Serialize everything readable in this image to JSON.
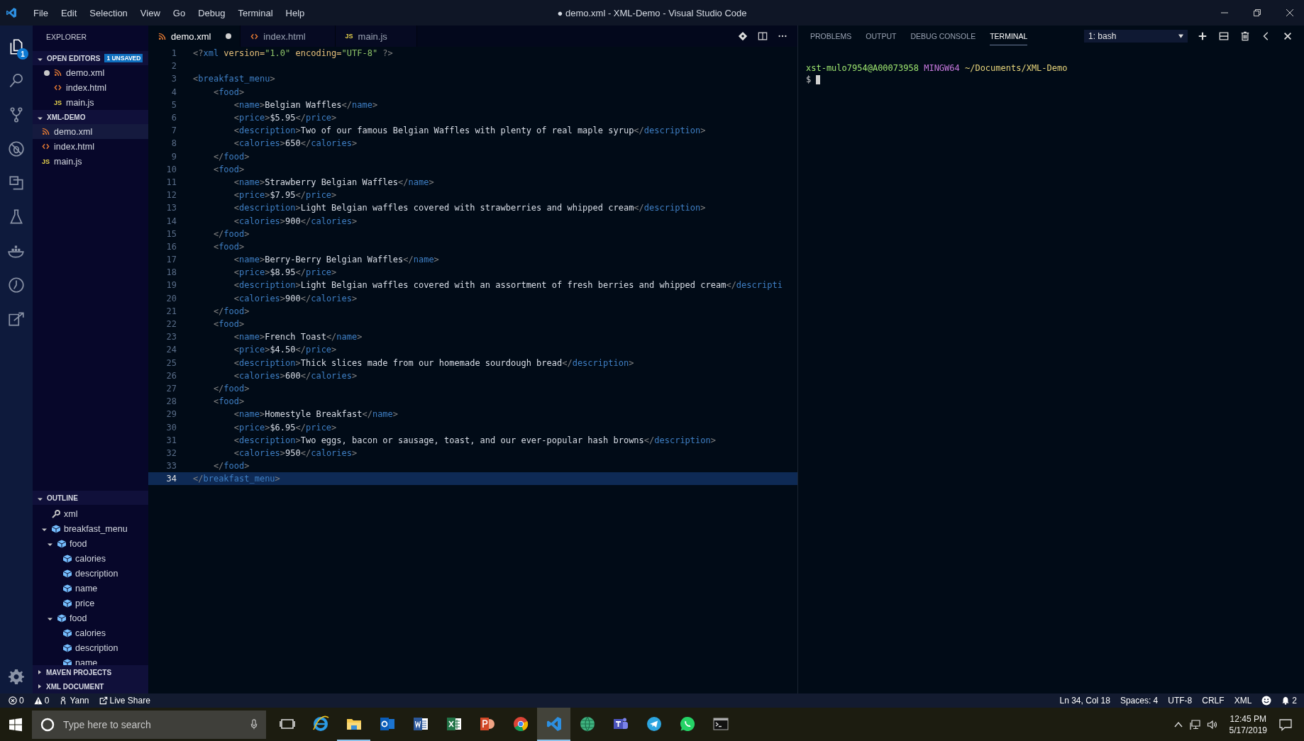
{
  "window": {
    "title": "● demo.xml - XML-Demo - Visual Studio Code"
  },
  "menu": [
    "File",
    "Edit",
    "Selection",
    "View",
    "Go",
    "Debug",
    "Terminal",
    "Help"
  ],
  "activity_bar": [
    {
      "kind": "files",
      "selected": true,
      "badge": "1"
    },
    {
      "kind": "search",
      "selected": false
    },
    {
      "kind": "source-control",
      "selected": false
    },
    {
      "kind": "debug",
      "selected": false
    },
    {
      "kind": "extensions",
      "selected": false
    },
    {
      "kind": "flask",
      "selected": false
    },
    {
      "kind": "whale",
      "selected": false
    },
    {
      "kind": "history",
      "selected": false
    },
    {
      "kind": "share",
      "selected": false
    }
  ],
  "sidebar": {
    "title": "EXPLORER",
    "open_editors": {
      "title": "OPEN EDITORS",
      "badge": "1 UNSAVED",
      "expanded": true,
      "items": [
        {
          "name": "demo.xml",
          "kind": "xml",
          "dirty": true,
          "selected": false
        },
        {
          "name": "index.html",
          "kind": "html",
          "dirty": false,
          "selected": false
        },
        {
          "name": "main.js",
          "kind": "js",
          "icon_label": "JS",
          "dirty": false,
          "selected": false
        }
      ]
    },
    "folder": {
      "title": "XML-DEMO",
      "expanded": true,
      "items": [
        {
          "name": "demo.xml",
          "kind": "xml",
          "selected": true
        },
        {
          "name": "index.html",
          "kind": "html",
          "selected": false
        },
        {
          "name": "main.js",
          "kind": "js",
          "icon_label": "JS",
          "selected": false
        }
      ]
    },
    "outline": {
      "title": "OUTLINE",
      "expanded": true,
      "items": [
        {
          "label": "xml",
          "kind": "key"
        },
        {
          "label": "breakfast_menu",
          "kind": "element",
          "expanded": true,
          "children": [
            {
              "label": "food",
              "kind": "element",
              "expanded": true,
              "children": [
                {
                  "label": "calories",
                  "kind": "element"
                },
                {
                  "label": "description",
                  "kind": "element"
                },
                {
                  "label": "name",
                  "kind": "element"
                },
                {
                  "label": "price",
                  "kind": "element"
                }
              ]
            },
            {
              "label": "food",
              "kind": "element",
              "expanded": true,
              "children": [
                {
                  "label": "calories",
                  "kind": "element"
                },
                {
                  "label": "description",
                  "kind": "element"
                },
                {
                  "label": "name",
                  "kind": "element"
                }
              ]
            }
          ]
        }
      ]
    },
    "collapsed_sections": [
      {
        "title": "MAVEN PROJECTS",
        "expanded": false
      },
      {
        "title": "XML DOCUMENT",
        "expanded": false
      }
    ]
  },
  "tabs": [
    {
      "label": "demo.xml",
      "kind": "xml",
      "dirty": true,
      "selected": true
    },
    {
      "label": "index.html",
      "kind": "html",
      "dirty": false,
      "selected": false
    },
    {
      "label": "main.js",
      "kind": "js",
      "icon_label": "JS",
      "dirty": false,
      "selected": false
    }
  ],
  "editor": {
    "lines": [
      {
        "n": "1",
        "current": false,
        "tokens": [
          {
            "kind": "mark",
            "text": "<?"
          },
          {
            "kind": "tag",
            "text": "xml"
          },
          {
            "kind": "attr",
            "text": " version="
          },
          {
            "kind": "str",
            "text": "\"1.0\""
          },
          {
            "kind": "attr",
            "text": " encoding="
          },
          {
            "kind": "str",
            "text": "\"UTF-8\""
          },
          {
            "kind": "mark",
            "text": " ?>"
          }
        ]
      },
      {
        "n": "2",
        "current": false
      },
      {
        "n": "3",
        "current": false,
        "tokens": [
          {
            "kind": "mark",
            "text": "<"
          },
          {
            "kind": "tag",
            "text": "breakfast_menu"
          },
          {
            "kind": "mark",
            "text": ">"
          }
        ]
      },
      {
        "n": "4",
        "current": false,
        "tokens": [
          {
            "kind": "mark",
            "text": "    <"
          },
          {
            "kind": "tag",
            "text": "food"
          },
          {
            "kind": "mark",
            "text": ">"
          }
        ]
      },
      {
        "n": "5",
        "current": false,
        "tokens": [
          {
            "kind": "mark",
            "text": "        <"
          },
          {
            "kind": "tag",
            "text": "name"
          },
          {
            "kind": "mark",
            "text": ">"
          },
          {
            "kind": "text",
            "text": "Belgian Waffles"
          },
          {
            "kind": "mark",
            "text": "</"
          },
          {
            "kind": "tag",
            "text": "name"
          },
          {
            "kind": "mark",
            "text": ">"
          }
        ]
      },
      {
        "n": "6",
        "current": false,
        "tokens": [
          {
            "kind": "mark",
            "text": "        <"
          },
          {
            "kind": "tag",
            "text": "price"
          },
          {
            "kind": "mark",
            "text": ">"
          },
          {
            "kind": "text",
            "text": "$5.95"
          },
          {
            "kind": "mark",
            "text": "</"
          },
          {
            "kind": "tag",
            "text": "price"
          },
          {
            "kind": "mark",
            "text": ">"
          }
        ]
      },
      {
        "n": "7",
        "current": false,
        "tokens": [
          {
            "kind": "mark",
            "text": "        <"
          },
          {
            "kind": "tag",
            "text": "description"
          },
          {
            "kind": "mark",
            "text": ">"
          },
          {
            "kind": "text",
            "text": "Two of our famous Belgian Waffles with plenty of real maple syrup"
          },
          {
            "kind": "mark",
            "text": "</"
          },
          {
            "kind": "tag",
            "text": "description"
          },
          {
            "kind": "mark",
            "text": ">"
          }
        ]
      },
      {
        "n": "8",
        "current": false,
        "tokens": [
          {
            "kind": "mark",
            "text": "        <"
          },
          {
            "kind": "tag",
            "text": "calories"
          },
          {
            "kind": "mark",
            "text": ">"
          },
          {
            "kind": "text",
            "text": "650"
          },
          {
            "kind": "mark",
            "text": "</"
          },
          {
            "kind": "tag",
            "text": "calories"
          },
          {
            "kind": "mark",
            "text": ">"
          }
        ]
      },
      {
        "n": "9",
        "current": false,
        "tokens": [
          {
            "kind": "mark",
            "text": "    </"
          },
          {
            "kind": "tag",
            "text": "food"
          },
          {
            "kind": "mark",
            "text": ">"
          }
        ]
      },
      {
        "n": "10",
        "current": false,
        "tokens": [
          {
            "kind": "mark",
            "text": "    <"
          },
          {
            "kind": "tag",
            "text": "food"
          },
          {
            "kind": "mark",
            "text": ">"
          }
        ]
      },
      {
        "n": "11",
        "current": false,
        "tokens": [
          {
            "kind": "mark",
            "text": "        <"
          },
          {
            "kind": "tag",
            "text": "name"
          },
          {
            "kind": "mark",
            "text": ">"
          },
          {
            "kind": "text",
            "text": "Strawberry Belgian Waffles"
          },
          {
            "kind": "mark",
            "text": "</"
          },
          {
            "kind": "tag",
            "text": "name"
          },
          {
            "kind": "mark",
            "text": ">"
          }
        ]
      },
      {
        "n": "12",
        "current": false,
        "tokens": [
          {
            "kind": "mark",
            "text": "        <"
          },
          {
            "kind": "tag",
            "text": "price"
          },
          {
            "kind": "mark",
            "text": ">"
          },
          {
            "kind": "text",
            "text": "$7.95"
          },
          {
            "kind": "mark",
            "text": "</"
          },
          {
            "kind": "tag",
            "text": "price"
          },
          {
            "kind": "mark",
            "text": ">"
          }
        ]
      },
      {
        "n": "13",
        "current": false,
        "tokens": [
          {
            "kind": "mark",
            "text": "        <"
          },
          {
            "kind": "tag",
            "text": "description"
          },
          {
            "kind": "mark",
            "text": ">"
          },
          {
            "kind": "text",
            "text": "Light Belgian waffles covered with strawberries and whipped cream"
          },
          {
            "kind": "mark",
            "text": "</"
          },
          {
            "kind": "tag",
            "text": "description"
          },
          {
            "kind": "mark",
            "text": ">"
          }
        ]
      },
      {
        "n": "14",
        "current": false,
        "tokens": [
          {
            "kind": "mark",
            "text": "        <"
          },
          {
            "kind": "tag",
            "text": "calories"
          },
          {
            "kind": "mark",
            "text": ">"
          },
          {
            "kind": "text",
            "text": "900"
          },
          {
            "kind": "mark",
            "text": "</"
          },
          {
            "kind": "tag",
            "text": "calories"
          },
          {
            "kind": "mark",
            "text": ">"
          }
        ]
      },
      {
        "n": "15",
        "current": false,
        "tokens": [
          {
            "kind": "mark",
            "text": "    </"
          },
          {
            "kind": "tag",
            "text": "food"
          },
          {
            "kind": "mark",
            "text": ">"
          }
        ]
      },
      {
        "n": "16",
        "current": false,
        "tokens": [
          {
            "kind": "mark",
            "text": "    <"
          },
          {
            "kind": "tag",
            "text": "food"
          },
          {
            "kind": "mark",
            "text": ">"
          }
        ]
      },
      {
        "n": "17",
        "current": false,
        "tokens": [
          {
            "kind": "mark",
            "text": "        <"
          },
          {
            "kind": "tag",
            "text": "name"
          },
          {
            "kind": "mark",
            "text": ">"
          },
          {
            "kind": "text",
            "text": "Berry-Berry Belgian Waffles"
          },
          {
            "kind": "mark",
            "text": "</"
          },
          {
            "kind": "tag",
            "text": "name"
          },
          {
            "kind": "mark",
            "text": ">"
          }
        ]
      },
      {
        "n": "18",
        "current": false,
        "tokens": [
          {
            "kind": "mark",
            "text": "        <"
          },
          {
            "kind": "tag",
            "text": "price"
          },
          {
            "kind": "mark",
            "text": ">"
          },
          {
            "kind": "text",
            "text": "$8.95"
          },
          {
            "kind": "mark",
            "text": "</"
          },
          {
            "kind": "tag",
            "text": "price"
          },
          {
            "kind": "mark",
            "text": ">"
          }
        ]
      },
      {
        "n": "19",
        "current": false,
        "tokens": [
          {
            "kind": "mark",
            "text": "        <"
          },
          {
            "kind": "tag",
            "text": "description"
          },
          {
            "kind": "mark",
            "text": ">"
          },
          {
            "kind": "text",
            "text": "Light Belgian waffles covered with an assortment of fresh berries and whipped cream"
          },
          {
            "kind": "mark",
            "text": "</"
          },
          {
            "kind": "tag",
            "text": "descripti"
          }
        ]
      },
      {
        "n": "20",
        "current": false,
        "tokens": [
          {
            "kind": "mark",
            "text": "        <"
          },
          {
            "kind": "tag",
            "text": "calories"
          },
          {
            "kind": "mark",
            "text": ">"
          },
          {
            "kind": "text",
            "text": "900"
          },
          {
            "kind": "mark",
            "text": "</"
          },
          {
            "kind": "tag",
            "text": "calories"
          },
          {
            "kind": "mark",
            "text": ">"
          }
        ]
      },
      {
        "n": "21",
        "current": false,
        "tokens": [
          {
            "kind": "mark",
            "text": "    </"
          },
          {
            "kind": "tag",
            "text": "food"
          },
          {
            "kind": "mark",
            "text": ">"
          }
        ]
      },
      {
        "n": "22",
        "current": false,
        "tokens": [
          {
            "kind": "mark",
            "text": "    <"
          },
          {
            "kind": "tag",
            "text": "food"
          },
          {
            "kind": "mark",
            "text": ">"
          }
        ]
      },
      {
        "n": "23",
        "current": false,
        "tokens": [
          {
            "kind": "mark",
            "text": "        <"
          },
          {
            "kind": "tag",
            "text": "name"
          },
          {
            "kind": "mark",
            "text": ">"
          },
          {
            "kind": "text",
            "text": "French Toast"
          },
          {
            "kind": "mark",
            "text": "</"
          },
          {
            "kind": "tag",
            "text": "name"
          },
          {
            "kind": "mark",
            "text": ">"
          }
        ]
      },
      {
        "n": "24",
        "current": false,
        "tokens": [
          {
            "kind": "mark",
            "text": "        <"
          },
          {
            "kind": "tag",
            "text": "price"
          },
          {
            "kind": "mark",
            "text": ">"
          },
          {
            "kind": "text",
            "text": "$4.50"
          },
          {
            "kind": "mark",
            "text": "</"
          },
          {
            "kind": "tag",
            "text": "price"
          },
          {
            "kind": "mark",
            "text": ">"
          }
        ]
      },
      {
        "n": "25",
        "current": false,
        "tokens": [
          {
            "kind": "mark",
            "text": "        <"
          },
          {
            "kind": "tag",
            "text": "description"
          },
          {
            "kind": "mark",
            "text": ">"
          },
          {
            "kind": "text",
            "text": "Thick slices made from our homemade sourdough bread"
          },
          {
            "kind": "mark",
            "text": "</"
          },
          {
            "kind": "tag",
            "text": "description"
          },
          {
            "kind": "mark",
            "text": ">"
          }
        ]
      },
      {
        "n": "26",
        "current": false,
        "tokens": [
          {
            "kind": "mark",
            "text": "        <"
          },
          {
            "kind": "tag",
            "text": "calories"
          },
          {
            "kind": "mark",
            "text": ">"
          },
          {
            "kind": "text",
            "text": "600"
          },
          {
            "kind": "mark",
            "text": "</"
          },
          {
            "kind": "tag",
            "text": "calories"
          },
          {
            "kind": "mark",
            "text": ">"
          }
        ]
      },
      {
        "n": "27",
        "current": false,
        "tokens": [
          {
            "kind": "mark",
            "text": "    </"
          },
          {
            "kind": "tag",
            "text": "food"
          },
          {
            "kind": "mark",
            "text": ">"
          }
        ]
      },
      {
        "n": "28",
        "current": false,
        "tokens": [
          {
            "kind": "mark",
            "text": "    <"
          },
          {
            "kind": "tag",
            "text": "food"
          },
          {
            "kind": "mark",
            "text": ">"
          }
        ]
      },
      {
        "n": "29",
        "current": false,
        "tokens": [
          {
            "kind": "mark",
            "text": "        <"
          },
          {
            "kind": "tag",
            "text": "name"
          },
          {
            "kind": "mark",
            "text": ">"
          },
          {
            "kind": "text",
            "text": "Homestyle Breakfast"
          },
          {
            "kind": "mark",
            "text": "</"
          },
          {
            "kind": "tag",
            "text": "name"
          },
          {
            "kind": "mark",
            "text": ">"
          }
        ]
      },
      {
        "n": "30",
        "current": false,
        "tokens": [
          {
            "kind": "mark",
            "text": "        <"
          },
          {
            "kind": "tag",
            "text": "price"
          },
          {
            "kind": "mark",
            "text": ">"
          },
          {
            "kind": "text",
            "text": "$6.95"
          },
          {
            "kind": "mark",
            "text": "</"
          },
          {
            "kind": "tag",
            "text": "price"
          },
          {
            "kind": "mark",
            "text": ">"
          }
        ]
      },
      {
        "n": "31",
        "current": false,
        "tokens": [
          {
            "kind": "mark",
            "text": "        <"
          },
          {
            "kind": "tag",
            "text": "description"
          },
          {
            "kind": "mark",
            "text": ">"
          },
          {
            "kind": "text",
            "text": "Two eggs, bacon or sausage, toast, and our ever-popular hash browns"
          },
          {
            "kind": "mark",
            "text": "</"
          },
          {
            "kind": "tag",
            "text": "description"
          },
          {
            "kind": "mark",
            "text": ">"
          }
        ]
      },
      {
        "n": "32",
        "current": false,
        "tokens": [
          {
            "kind": "mark",
            "text": "        <"
          },
          {
            "kind": "tag",
            "text": "calories"
          },
          {
            "kind": "mark",
            "text": ">"
          },
          {
            "kind": "text",
            "text": "950"
          },
          {
            "kind": "mark",
            "text": "</"
          },
          {
            "kind": "tag",
            "text": "calories"
          },
          {
            "kind": "mark",
            "text": ">"
          }
        ]
      },
      {
        "n": "33",
        "current": false,
        "tokens": [
          {
            "kind": "mark",
            "text": "    </"
          },
          {
            "kind": "tag",
            "text": "food"
          },
          {
            "kind": "mark",
            "text": ">"
          }
        ]
      },
      {
        "n": "34",
        "current": true,
        "tokens": [
          {
            "kind": "mark",
            "text": "</"
          },
          {
            "kind": "tag",
            "text": "breakfast_menu"
          },
          {
            "kind": "mark",
            "text": ">"
          }
        ]
      }
    ]
  },
  "panel": {
    "tabs": [
      {
        "label": "PROBLEMS",
        "selected": false
      },
      {
        "label": "OUTPUT",
        "selected": false
      },
      {
        "label": "DEBUG CONSOLE",
        "selected": false
      },
      {
        "label": "TERMINAL",
        "selected": true
      }
    ],
    "terminal_select": {
      "value": "1: bash"
    },
    "terminal_lines": [
      {
        "segments": [
          {
            "kind": "user",
            "text": "xst-mulo7954@A00073958"
          },
          {
            "kind": "shell",
            "text": " MINGW64"
          },
          {
            "kind": "path",
            "text": " ~/Documents/XML-Demo"
          }
        ]
      },
      {
        "segments": [
          {
            "kind": "text",
            "text": "$"
          }
        ],
        "cursor": true
      }
    ]
  },
  "status_bar": {
    "left": [
      {
        "kind": "errors",
        "text": "0"
      },
      {
        "kind": "warnings",
        "text": "0"
      },
      {
        "kind": "account",
        "text": "Yann"
      },
      {
        "kind": "share",
        "text": "Live Share"
      }
    ],
    "right": [
      {
        "kind": "plain",
        "text": "Ln 34, Col 18"
      },
      {
        "kind": "plain",
        "text": "Spaces: 4"
      },
      {
        "kind": "plain",
        "text": "UTF-8"
      },
      {
        "kind": "plain",
        "text": "CRLF"
      },
      {
        "kind": "plain",
        "text": "XML"
      },
      {
        "kind": "feedback"
      },
      {
        "kind": "bell",
        "text": "2"
      }
    ]
  },
  "taskbar": {
    "search": {
      "placeholder": "Type here to search"
    },
    "apps": [
      {
        "kind": "task-view",
        "active": false,
        "running": false
      },
      {
        "kind": "ie",
        "active": false,
        "running": false
      },
      {
        "kind": "folder",
        "active": false,
        "running": true
      },
      {
        "kind": "outlook",
        "active": false,
        "running": false
      },
      {
        "kind": "word",
        "active": false,
        "running": false
      },
      {
        "kind": "excel",
        "active": false,
        "running": false
      },
      {
        "kind": "powerpoint",
        "active": false,
        "running": false
      },
      {
        "kind": "chrome",
        "active": false,
        "running": false
      },
      {
        "kind": "vscode",
        "active": true,
        "running": true
      },
      {
        "kind": "globe",
        "active": false,
        "running": false
      },
      {
        "kind": "teams",
        "active": false,
        "running": false
      },
      {
        "kind": "telegram",
        "active": false,
        "running": false
      },
      {
        "kind": "whatsapp",
        "active": false,
        "running": false
      },
      {
        "kind": "console",
        "active": false,
        "running": false
      }
    ],
    "time": "12:45 PM",
    "date": "5/17/2019"
  }
}
